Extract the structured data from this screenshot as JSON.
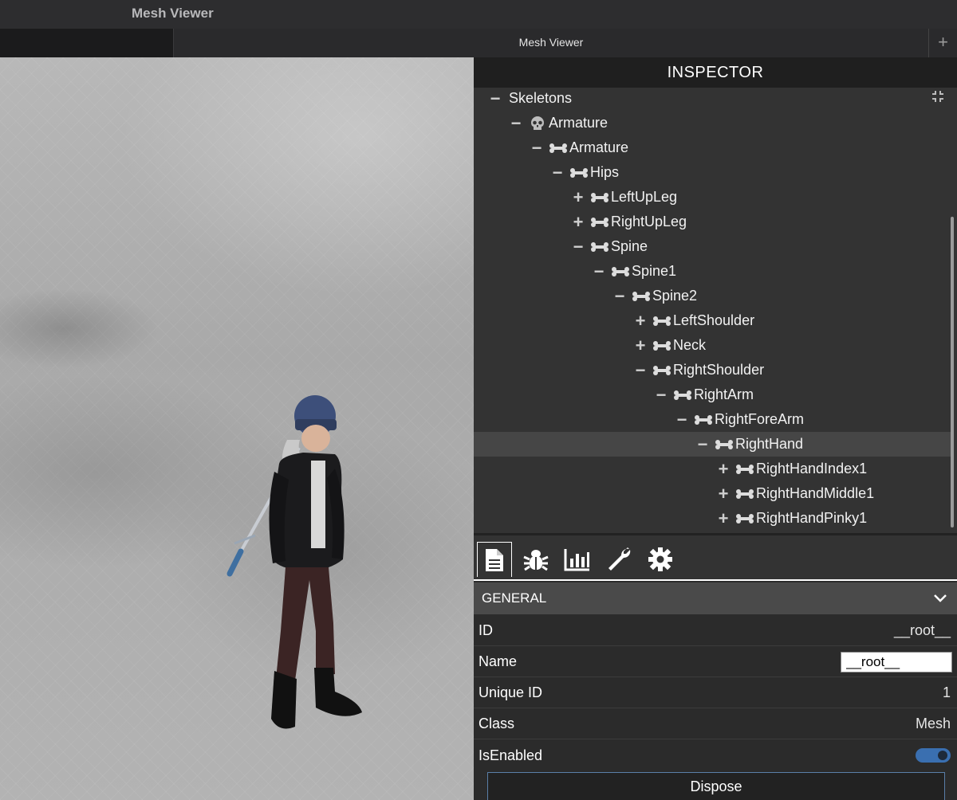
{
  "window": {
    "title": "Mesh Viewer"
  },
  "tabs": {
    "active_label": "Mesh Viewer",
    "new_tab_label": "+"
  },
  "inspector": {
    "title": "INSPECTOR",
    "tree": [
      {
        "label": "Skeletons",
        "toggle": "−",
        "icon": "none",
        "depth": 0
      },
      {
        "label": "Armature",
        "toggle": "−",
        "icon": "skull-icon",
        "depth": 1
      },
      {
        "label": "Armature",
        "toggle": "−",
        "icon": "bone-icon",
        "depth": 2
      },
      {
        "label": "Hips",
        "toggle": "−",
        "icon": "bone-icon",
        "depth": 3
      },
      {
        "label": "LeftUpLeg",
        "toggle": "+",
        "icon": "bone-icon",
        "depth": 4
      },
      {
        "label": "RightUpLeg",
        "toggle": "+",
        "icon": "bone-icon",
        "depth": 4
      },
      {
        "label": "Spine",
        "toggle": "−",
        "icon": "bone-icon",
        "depth": 4
      },
      {
        "label": "Spine1",
        "toggle": "−",
        "icon": "bone-icon",
        "depth": 5
      },
      {
        "label": "Spine2",
        "toggle": "−",
        "icon": "bone-icon",
        "depth": 6
      },
      {
        "label": "LeftShoulder",
        "toggle": "+",
        "icon": "bone-icon",
        "depth": 7
      },
      {
        "label": "Neck",
        "toggle": "+",
        "icon": "bone-icon",
        "depth": 7
      },
      {
        "label": "RightShoulder",
        "toggle": "−",
        "icon": "bone-icon",
        "depth": 7
      },
      {
        "label": "RightArm",
        "toggle": "−",
        "icon": "bone-icon",
        "depth": 8
      },
      {
        "label": "RightForeArm",
        "toggle": "−",
        "icon": "bone-icon",
        "depth": 9
      },
      {
        "label": "RightHand",
        "toggle": "−",
        "icon": "bone-icon",
        "depth": 10,
        "selected": true
      },
      {
        "label": "RightHandIndex1",
        "toggle": "+",
        "icon": "bone-icon",
        "depth": 11
      },
      {
        "label": "RightHandMiddle1",
        "toggle": "+",
        "icon": "bone-icon",
        "depth": 11
      },
      {
        "label": "RightHandPinky1",
        "toggle": "+",
        "icon": "bone-icon",
        "depth": 11
      }
    ],
    "toolbar": [
      {
        "name": "properties-tab",
        "icon": "document-icon",
        "active": true
      },
      {
        "name": "debug-tab",
        "icon": "bug-icon",
        "active": false
      },
      {
        "name": "statistics-tab",
        "icon": "chart-icon",
        "active": false
      },
      {
        "name": "tools-tab",
        "icon": "wrench-icon",
        "active": false
      },
      {
        "name": "settings-tab",
        "icon": "gear-icon",
        "active": false
      }
    ],
    "general": {
      "title": "GENERAL",
      "id_label": "ID",
      "id_value": "__root__",
      "name_label": "Name",
      "name_value": "__root__",
      "unique_id_label": "Unique ID",
      "unique_id_value": "1",
      "class_label": "Class",
      "class_value": "Mesh",
      "isenabled_label": "IsEnabled",
      "isenabled_value": true,
      "dispose_label": "Dispose"
    }
  },
  "colors": {
    "accent": "#3a6fb0",
    "panel": "#333333",
    "header": "#1f1f1f"
  }
}
